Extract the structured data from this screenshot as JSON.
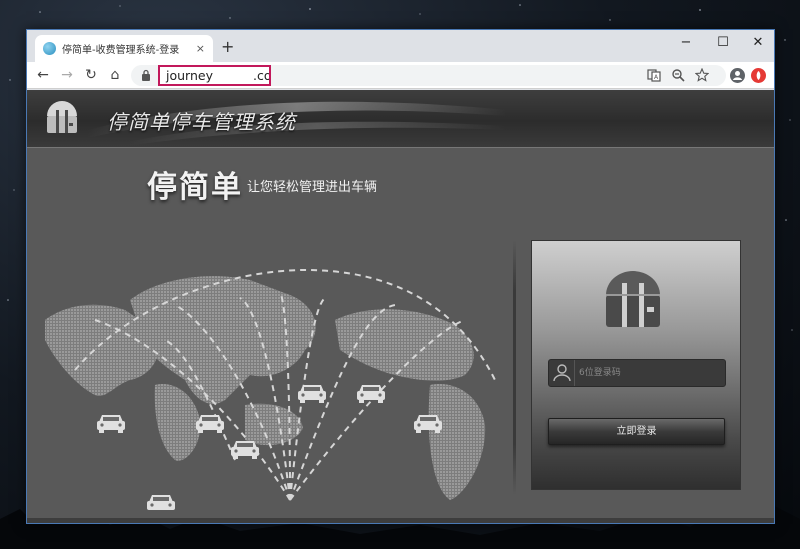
{
  "browser": {
    "tab_title": "停简单-收费管理系统-登录",
    "tab_close": "×",
    "new_tab": "+",
    "url_visible_start": "journey",
    "url_visible_end": ".co",
    "window_controls": {
      "minimize": "−",
      "maximize": "☐",
      "close": "✕"
    },
    "nav": {
      "back": "←",
      "forward": "→",
      "reload": "↻",
      "home": "⌂"
    }
  },
  "header": {
    "system_title": "停简单停车管理系统"
  },
  "brand": {
    "name": "停简单",
    "slogan": "让您轻松管理进出车辆"
  },
  "login": {
    "username_placeholder": "6位登录码",
    "submit_label": "立即登录"
  },
  "colors": {
    "page_bg": "#595959",
    "header_bg": "#2c2c2c",
    "url_highlight": "#c2185b",
    "window_border": "#4a79b5"
  },
  "icons": [
    "favicon",
    "lock-icon",
    "translate-icon",
    "zoom-icon",
    "star-icon",
    "profile-icon",
    "extension-icon",
    "parking-logo-icon",
    "user-icon",
    "car-icon"
  ]
}
